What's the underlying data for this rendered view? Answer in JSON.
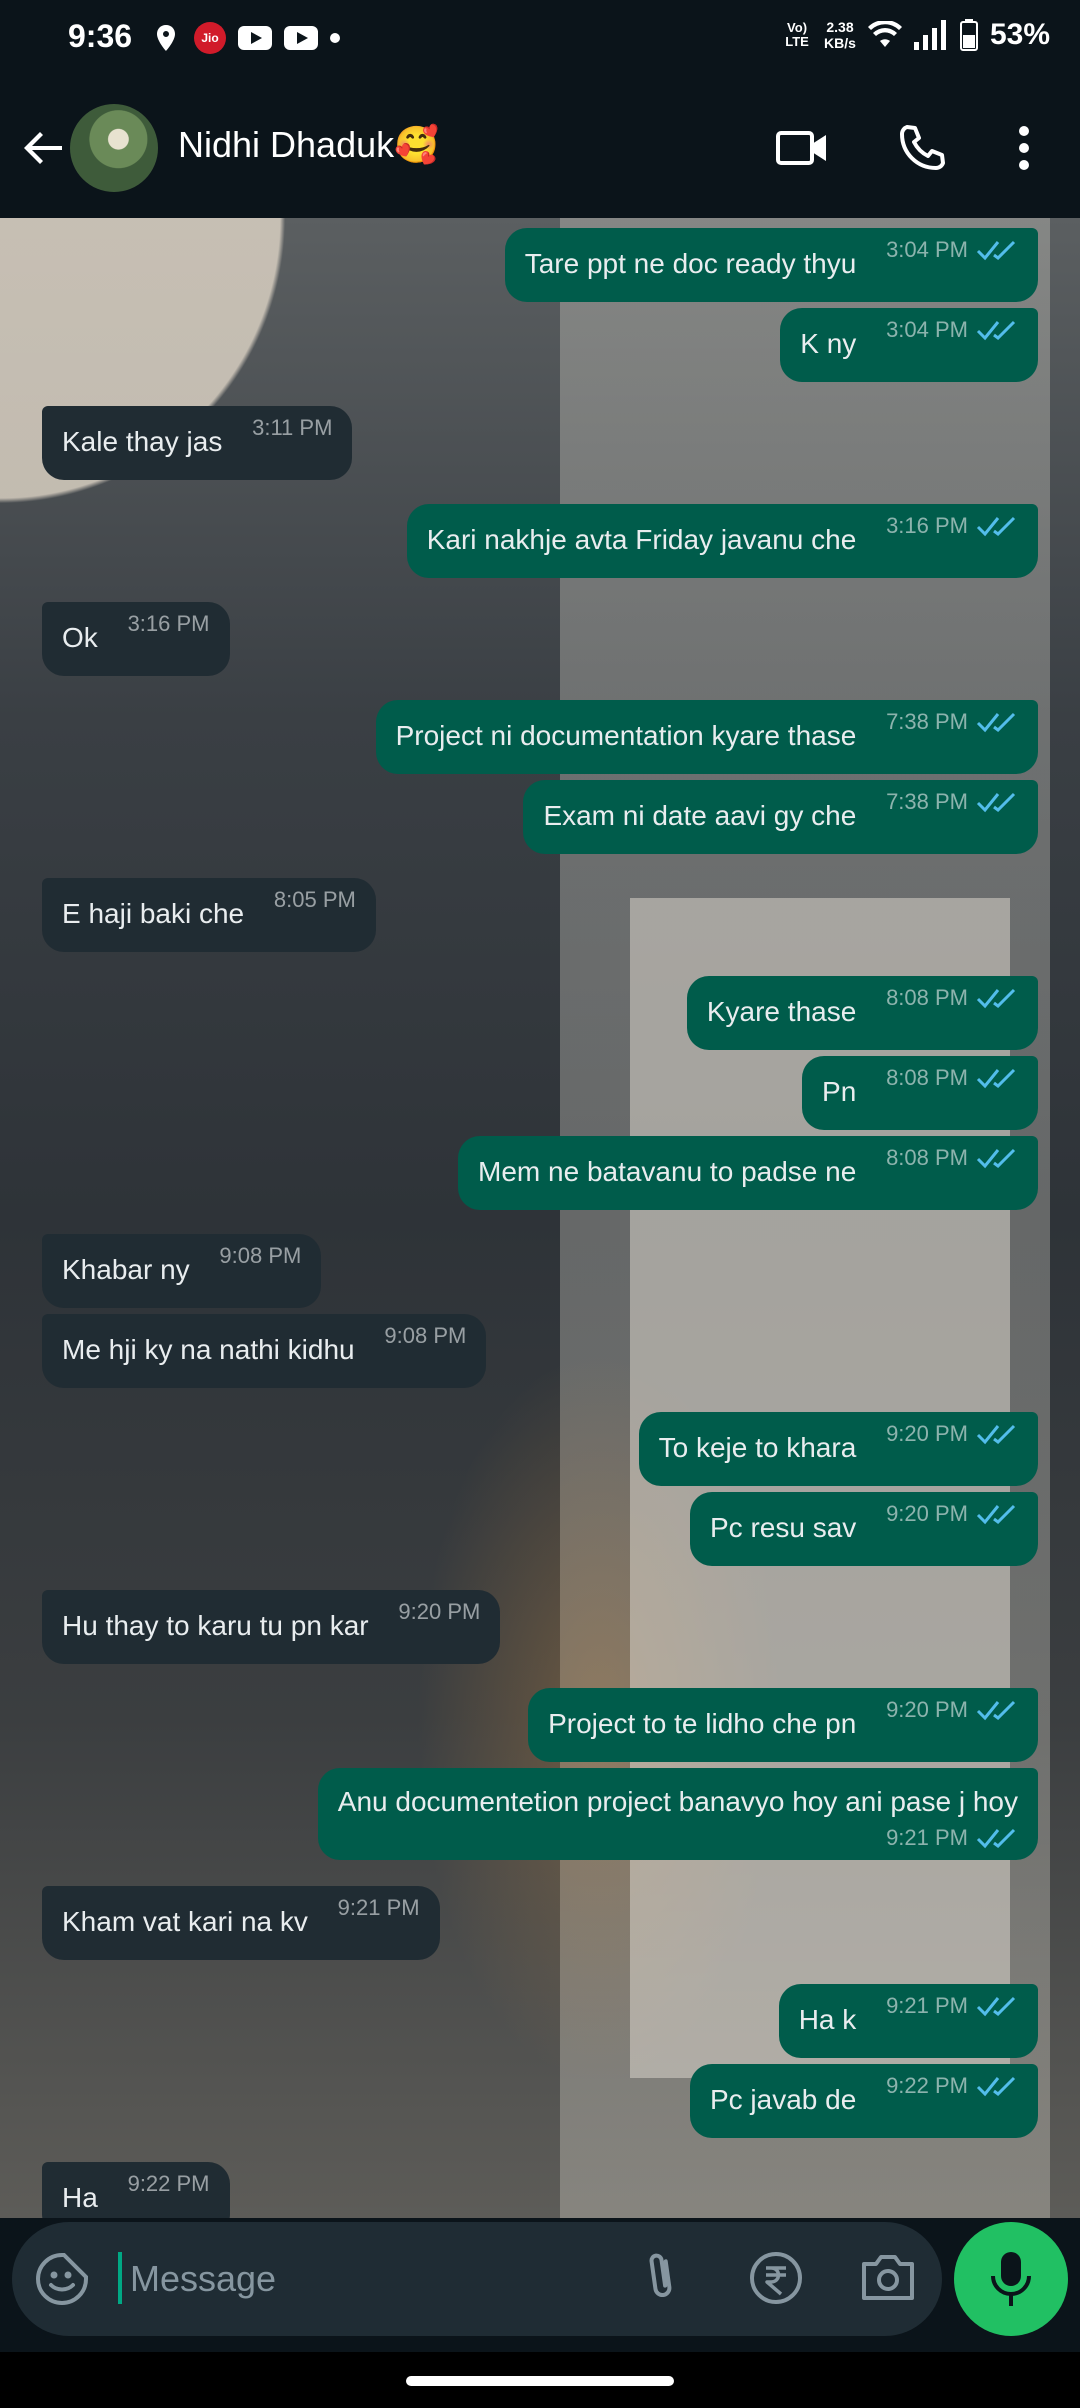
{
  "status_bar": {
    "time": "9:36",
    "jio_label": "Jio",
    "volte": "Vo) LTE",
    "speed_value": "2.38",
    "speed_unit": "KB/s",
    "battery": "53%"
  },
  "header": {
    "contact_name": "Nidhi Dhaduk🥰"
  },
  "messages": [
    {
      "dir": "out",
      "text": "Tare ppt ne doc ready thyu",
      "time": "3:04 PM",
      "read": true
    },
    {
      "dir": "out",
      "text": "K ny",
      "time": "3:04 PM",
      "read": true
    },
    {
      "dir": "in",
      "text": "Kale thay jas",
      "time": "3:11 PM"
    },
    {
      "dir": "out",
      "text": "Kari nakhje avta Friday javanu che",
      "time": "3:16 PM",
      "read": true
    },
    {
      "dir": "in",
      "text": "Ok",
      "time": "3:16 PM"
    },
    {
      "dir": "out",
      "text": "Project ni documentation kyare thase",
      "time": "7:38 PM",
      "read": true
    },
    {
      "dir": "out",
      "text": "Exam ni date aavi gy che",
      "time": "7:38 PM",
      "read": true
    },
    {
      "dir": "in",
      "text": "E haji baki che",
      "time": "8:05 PM"
    },
    {
      "dir": "out",
      "text": "Kyare thase",
      "time": "8:08 PM",
      "read": true
    },
    {
      "dir": "out",
      "text": "Pn",
      "time": "8:08 PM",
      "read": true
    },
    {
      "dir": "out",
      "text": "Mem ne batavanu to padse ne",
      "time": "8:08 PM",
      "read": true
    },
    {
      "dir": "in",
      "text": "Khabar ny",
      "time": "9:08 PM"
    },
    {
      "dir": "in",
      "text": "Me hji ky na nathi kidhu",
      "time": "9:08 PM"
    },
    {
      "dir": "out",
      "text": "To keje to khara",
      "time": "9:20 PM",
      "read": true
    },
    {
      "dir": "out",
      "text": "Pc resu sav",
      "time": "9:20 PM",
      "read": true
    },
    {
      "dir": "in",
      "text": "Hu thay to karu tu pn kar",
      "time": "9:20 PM"
    },
    {
      "dir": "out",
      "text": "Project to te lidho che pn",
      "time": "9:20 PM",
      "read": true
    },
    {
      "dir": "out",
      "text": "Anu documentetion project banavyo hoy ani pase j hoy",
      "time": "9:21 PM",
      "read": true
    },
    {
      "dir": "in",
      "text": "Kham vat kari na kv",
      "time": "9:21 PM"
    },
    {
      "dir": "out",
      "text": "Ha k",
      "time": "9:21 PM",
      "read": true
    },
    {
      "dir": "out",
      "text": "Pc javab de",
      "time": "9:22 PM",
      "read": true
    },
    {
      "dir": "in",
      "text": "Ha",
      "time": "9:22 PM"
    }
  ],
  "composer": {
    "placeholder": "Message"
  },
  "icons": {
    "back": "back-arrow-icon",
    "video": "video-call-icon",
    "call": "phone-icon",
    "menu": "more-vertical-icon",
    "emoji": "sticker-icon",
    "attach": "paperclip-icon",
    "pay": "rupee-icon",
    "camera": "camera-icon",
    "mic": "mic-icon"
  },
  "colors": {
    "outgoing_bubble": "#005c4b",
    "incoming_bubble": "#202c33",
    "read_ticks": "#53bdeb",
    "mic_button": "#21c063"
  }
}
